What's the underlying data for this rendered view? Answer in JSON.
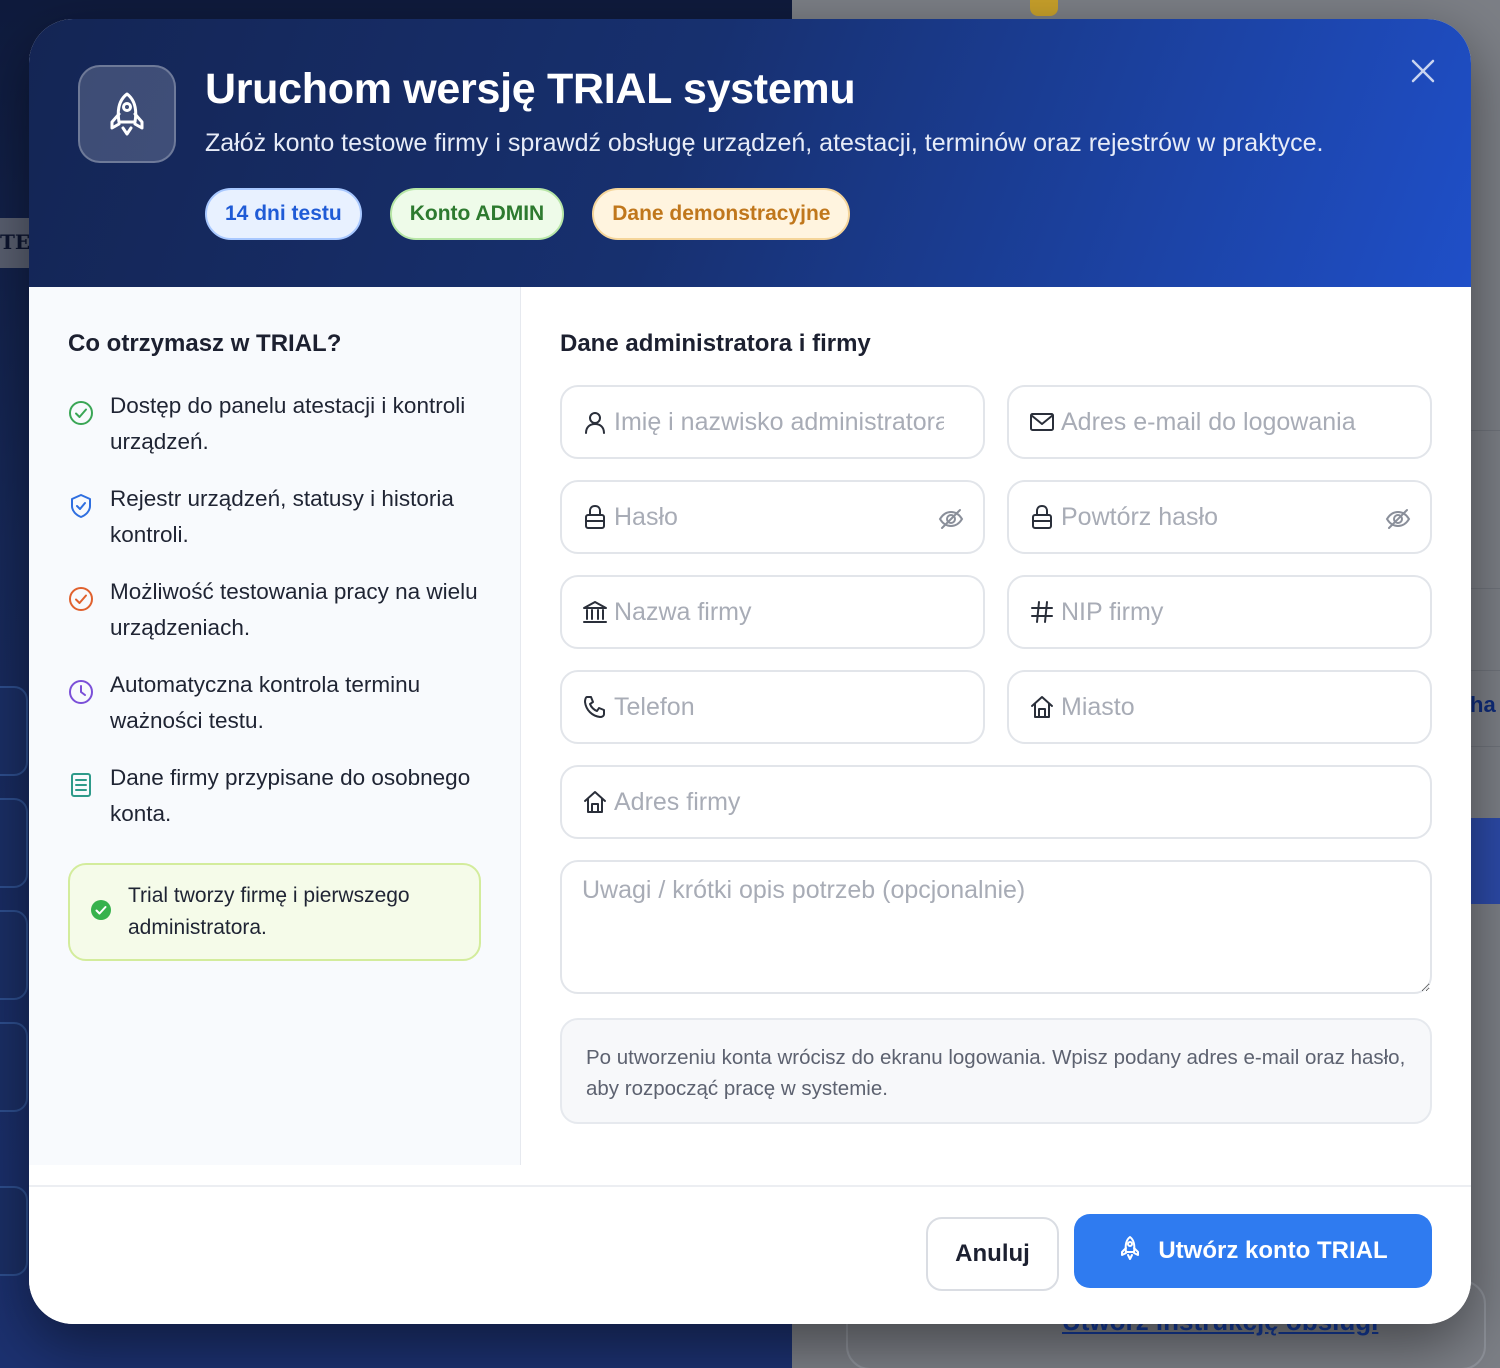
{
  "modal": {
    "title": "Uruchom wersję TRIAL systemu",
    "subtitle": "Załóż konto testowe firmy i sprawdź obsługę urządzeń, atestacji, terminów oraz rejestrów w praktyce.",
    "badges": [
      "14 dni testu",
      "Konto ADMIN",
      "Dane demonstracyjne"
    ]
  },
  "benefits": {
    "heading": "Co otrzymasz w TRIAL?",
    "items": [
      {
        "text": "Dostęp do panelu atestacji i kontroli urządzeń.",
        "icon": "check-circle-icon",
        "color": "#3aa655"
      },
      {
        "text": "Rejestr urządzeń, statusy i historia kontroli.",
        "icon": "shield-check-icon",
        "color": "#2f6fe0"
      },
      {
        "text": "Możliwość testowania pracy na wielu urządzeniach.",
        "icon": "check-circle-icon",
        "color": "#e0612e"
      },
      {
        "text": "Automatyczna kontrola terminu ważności testu.",
        "icon": "clock-icon",
        "color": "#7b4fd8"
      },
      {
        "text": "Dane firmy przypisane do osobnego konta.",
        "icon": "document-icon",
        "color": "#2e9a8a"
      }
    ],
    "note": "Trial tworzy firmę i pierwszego administratora."
  },
  "form": {
    "heading": "Dane administratora i firmy",
    "fields": {
      "admin_name": {
        "placeholder": "Imię i nazwisko administratora",
        "value": ""
      },
      "email": {
        "placeholder": "Adres e-mail do logowania",
        "value": ""
      },
      "password": {
        "placeholder": "Hasło",
        "value": ""
      },
      "password_repeat": {
        "placeholder": "Powtórz hasło",
        "value": ""
      },
      "company_name": {
        "placeholder": "Nazwa firmy",
        "value": ""
      },
      "nip": {
        "placeholder": "NIP firmy",
        "value": ""
      },
      "phone": {
        "placeholder": "Telefon",
        "value": ""
      },
      "city": {
        "placeholder": "Miasto",
        "value": ""
      },
      "address": {
        "placeholder": "Adres firmy",
        "value": ""
      },
      "notes": {
        "placeholder": "Uwagi / krótki opis potrzeb (opcjonalnie)",
        "value": ""
      }
    },
    "info": "Po utworzeniu konta wrócisz do ekranu logowania. Wpisz podany adres e-mail oraz hasło, aby rozpocząć pracę w systemie."
  },
  "footer": {
    "cancel_label": "Anuluj",
    "create_label": "Utwórz konto TRIAL"
  },
  "background": {
    "te_text": "TE",
    "link_text": "Utwórz instrukcję obsługi",
    "side_text": "ha"
  },
  "colors": {
    "accent": "#2f7bf0",
    "header_dark": "#142554",
    "header_light": "#1f4fc8"
  }
}
